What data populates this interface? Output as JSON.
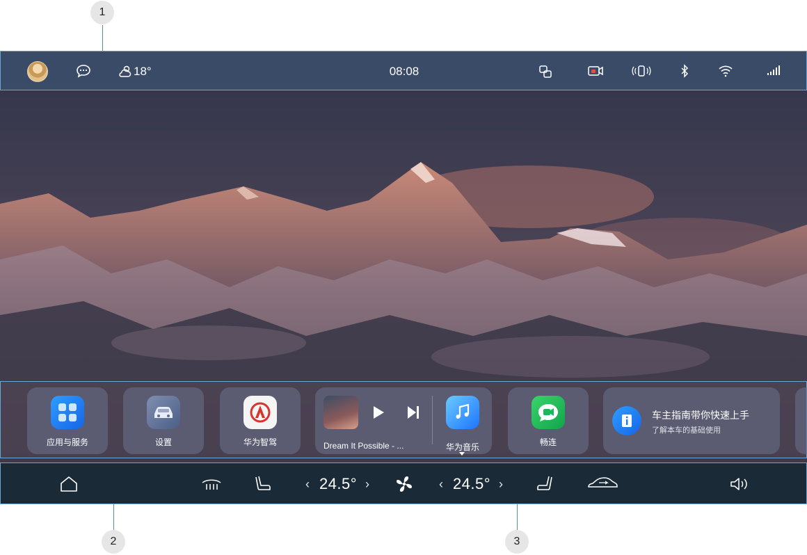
{
  "callouts": [
    "1",
    "2",
    "3"
  ],
  "status_bar": {
    "weather_temp": "18°",
    "time": "08:08"
  },
  "dock": {
    "apps": [
      {
        "label": "应用与服务"
      },
      {
        "label": "设置"
      },
      {
        "label": "华为智驾"
      }
    ],
    "music": {
      "track_title": "Dream It Possible - ...",
      "app_label": "华为音乐"
    },
    "link_app": {
      "label": "畅连"
    },
    "guide": {
      "title": "车主指南带你快速上手",
      "subtitle": "了解本车的基础使用"
    }
  },
  "control_bar": {
    "left_temp": "24.5°",
    "right_temp": "24.5°"
  },
  "icons": {
    "status": [
      "avatar",
      "message-icon",
      "weather-icon",
      "screen-cast-icon",
      "dashcam-icon",
      "vibration-icon",
      "bluetooth-icon",
      "wifi-icon",
      "signal-icon"
    ],
    "controls": [
      "home-icon",
      "defrost-icon",
      "seat-left-icon",
      "fan-icon",
      "seat-right-icon",
      "car-recirculation-icon",
      "volume-icon"
    ]
  },
  "colors": {
    "accent_blue": "#2f9cff",
    "callout_line": "#4a90c8",
    "control_bar_bg": "#1a2a37"
  }
}
